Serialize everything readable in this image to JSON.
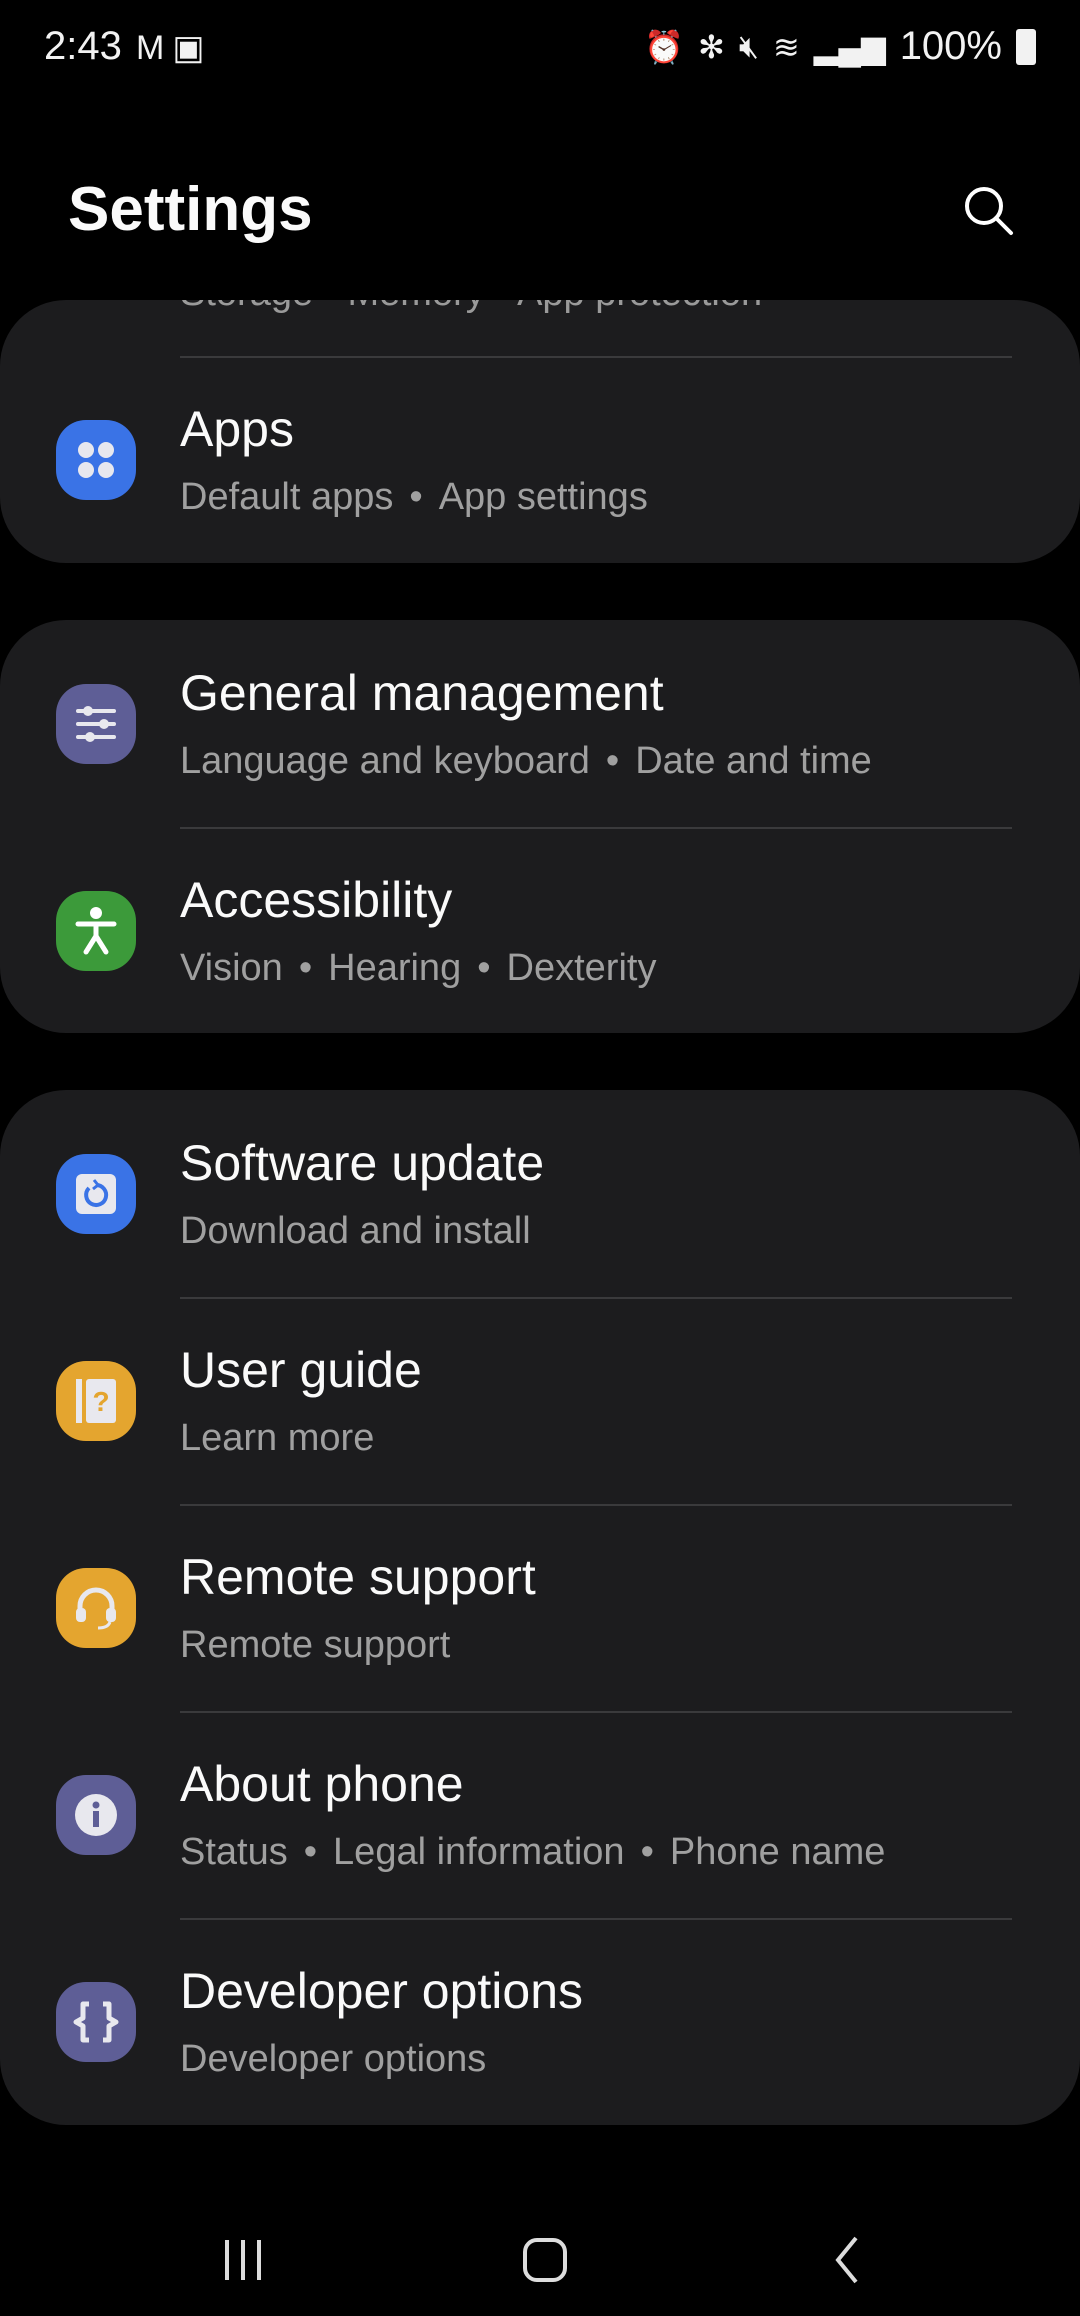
{
  "status_bar": {
    "time": "2:43",
    "battery": "100%",
    "left_icons": [
      "gmail-icon",
      "gallery-icon"
    ],
    "right_icons": [
      "alarm-icon",
      "bluetooth-icon",
      "mute-icon",
      "wifi-icon",
      "signal-icon",
      "battery-icon"
    ]
  },
  "header": {
    "title": "Settings"
  },
  "partial_item": {
    "subtitle": [
      "Storage",
      "Memory",
      "App protection"
    ]
  },
  "groups": [
    {
      "items": [
        {
          "title": "Apps",
          "subtitle": [
            "Default apps",
            "App settings"
          ],
          "icon": "apps-icon",
          "color": "#3a73e6"
        }
      ]
    },
    {
      "items": [
        {
          "title": "General management",
          "subtitle": [
            "Language and keyboard",
            "Date and time"
          ],
          "icon": "sliders-icon",
          "color": "#5e5e96"
        },
        {
          "title": "Accessibility",
          "subtitle": [
            "Vision",
            "Hearing",
            "Dexterity"
          ],
          "icon": "accessibility-icon",
          "color": "#3c9a3a"
        }
      ]
    },
    {
      "items": [
        {
          "title": "Software update",
          "subtitle": [
            "Download and install"
          ],
          "icon": "update-icon",
          "color": "#3a73e6"
        },
        {
          "title": "User guide",
          "subtitle": [
            "Learn more"
          ],
          "icon": "user-guide-icon",
          "color": "#e4a52f"
        },
        {
          "title": "Remote support",
          "subtitle": [
            "Remote support"
          ],
          "icon": "headset-icon",
          "color": "#e4a52f"
        },
        {
          "title": "About phone",
          "subtitle": [
            "Status",
            "Legal information",
            "Phone name"
          ],
          "icon": "info-icon",
          "color": "#5e5e96"
        },
        {
          "title": "Developer options",
          "subtitle": [
            "Developer options"
          ],
          "icon": "braces-icon",
          "color": "#5e5e96"
        }
      ]
    }
  ]
}
